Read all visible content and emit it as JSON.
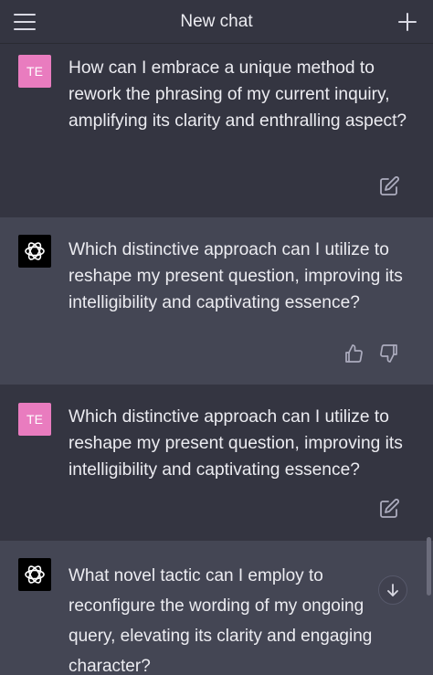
{
  "header": {
    "title": "New chat"
  },
  "messages": [
    {
      "role": "user",
      "avatar": "TE",
      "text": "How can I embrace a unique method to rework the phrasing of my current inquiry, amplifying its clarity and enthralling aspect?"
    },
    {
      "role": "assistant",
      "text": "Which distinctive approach can I utilize to reshape my present question, improving its intelligibility and captivating essence?"
    },
    {
      "role": "user",
      "avatar": "TE",
      "text": "Which distinctive approach can I utilize to reshape my present question, improving its intelligibility and captivating essence?"
    },
    {
      "role": "assistant",
      "text": "What novel tactic can I employ to reconfigure the wording of my ongoing query, elevating its clarity and engaging character?"
    }
  ],
  "colors": {
    "background": "#343541",
    "assistant_background": "#444654",
    "user_avatar": "#e97cbf",
    "text": "#ececf1"
  },
  "icons": {
    "menu": "hamburger-menu-icon",
    "new_chat": "plus-icon",
    "edit": "edit-icon",
    "thumbs_up": "thumbs-up-icon",
    "thumbs_down": "thumbs-down-icon",
    "scroll_down": "arrow-down-icon",
    "assistant_avatar": "openai-logo-icon"
  }
}
